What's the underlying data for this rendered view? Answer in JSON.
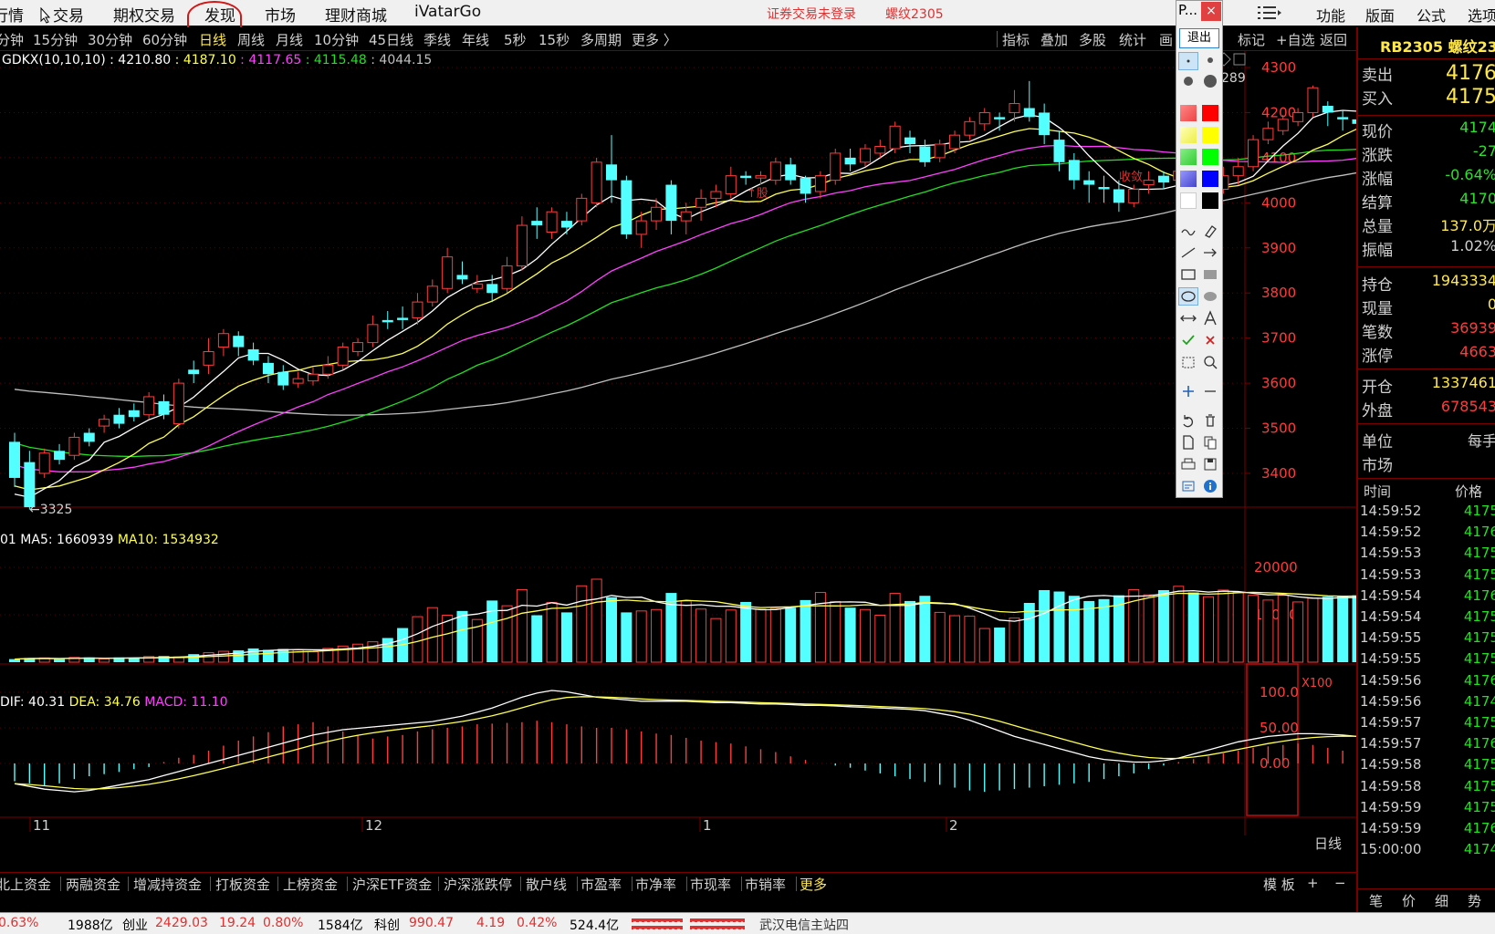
{
  "menu": {
    "items": [
      "行情",
      "交易",
      "期权交易",
      "发现",
      "市场",
      "理财商城",
      "iVatarGo"
    ],
    "notice_login": "证券交易未登录",
    "notice_contract": "螺纹2305",
    "right_items": [
      "功能",
      "版面",
      "公式",
      "选项"
    ]
  },
  "periods": [
    "分钟",
    "15分钟",
    "30分钟",
    "60分钟",
    "日线",
    "周线",
    "月线",
    "10分钟",
    "45日线",
    "季线",
    "年线",
    "5秒",
    "15秒",
    "多周期",
    "更多 〉"
  ],
  "period_active": "日线",
  "toolbar": [
    "指标",
    "叠加",
    "多股",
    "统计",
    "画",
    "标记",
    "+自选",
    "返回"
  ],
  "main_indicator": {
    "name": "GDKX(10,10,10)",
    "v1": "4210.80",
    "v2": "4187.10",
    "v3": "4117.65",
    "v4": "4115.48",
    "v5": "4044.15"
  },
  "annotations": {
    "low": "←3325",
    "high": "289",
    "text_a": "↑股",
    "text_b": "收敛"
  },
  "volume_indicator": {
    "prefix": "01",
    "ma5_label": "MA5:",
    "ma5": "1660939",
    "ma10_label": "MA10:",
    "ma10": "1534932",
    "unit": "X100"
  },
  "macd_indicator": {
    "dif_label": "DIF:",
    "dif": "40.31",
    "dea_label": "DEA:",
    "dea": "34.76",
    "macd_label": "MACD:",
    "macd": "11.10"
  },
  "period_label": "日线",
  "fund_bar": [
    "北上资金",
    "两融资金",
    "增减持资金",
    "打板资金",
    "上榜资金",
    "沪深ETF资金",
    "沪深涨跌停",
    "散户线",
    "市盈率",
    "市净率",
    "市现率",
    "市销率",
    "更多"
  ],
  "fund_right": [
    "模 板",
    "+",
    "−"
  ],
  "status": {
    "change": "0.63%",
    "amount1": "1988亿",
    "cy_label": "创业",
    "cy_price": "2429.03",
    "cy_chg": "19.24",
    "cy_pct": "0.80%",
    "amount2": "1584亿",
    "kc_label": "科创",
    "kc_price": "990.47",
    "kc_chg": "4.19",
    "kc_pct": "0.42%",
    "amount3": "524.4亿",
    "server": "武汉电信主站四"
  },
  "quote": {
    "title": "RB2305 螺纹23",
    "rows": [
      {
        "label": "卖出",
        "value": "4176",
        "color": "#ffe84a"
      },
      {
        "label": "买入",
        "value": "4175",
        "color": "#ffe84a"
      },
      {
        "label": "现价",
        "value": "4174",
        "color": "#2ee02e"
      },
      {
        "label": "涨跌",
        "value": "-27",
        "color": "#2ee02e"
      },
      {
        "label": "涨幅",
        "value": "-0.64%",
        "color": "#2ee02e"
      },
      {
        "label": "结算",
        "value": "4170",
        "color": "#2ee02e"
      },
      {
        "label": "总量",
        "value": "137.0万",
        "color": "#ffe84a"
      },
      {
        "label": "振幅",
        "value": "1.02%",
        "color": "#d0d0d0"
      },
      {
        "label": "持仓",
        "value": "1943334",
        "color": "#ffe84a"
      },
      {
        "label": "现量",
        "value": "0",
        "color": "#ffe84a"
      },
      {
        "label": "笔数",
        "value": "36939",
        "color": "#ff3c3c"
      },
      {
        "label": "涨停",
        "value": "4663",
        "color": "#ff3c3c"
      },
      {
        "label": "开仓",
        "value": "1337461",
        "color": "#ffe84a"
      },
      {
        "label": "外盘",
        "value": "678543",
        "color": "#ff3c3c"
      },
      {
        "label": "单位",
        "value": "每手",
        "color": "#d0d0d0"
      },
      {
        "label": "市场",
        "value": "",
        "color": "#d0d0d0"
      }
    ]
  },
  "ticks_header": {
    "time": "时间",
    "price": "价格"
  },
  "ticks": [
    {
      "time": "14:59:52",
      "price": "4175"
    },
    {
      "time": "14:59:52",
      "price": "4176"
    },
    {
      "time": "14:59:53",
      "price": "4175"
    },
    {
      "time": "14:59:53",
      "price": "4175"
    },
    {
      "time": "14:59:54",
      "price": "4176"
    },
    {
      "time": "14:59:54",
      "price": "4175"
    },
    {
      "time": "14:59:55",
      "price": "4175"
    },
    {
      "time": "14:59:55",
      "price": "4175"
    },
    {
      "time": "14:59:56",
      "price": "4176"
    },
    {
      "time": "14:59:56",
      "price": "4174"
    },
    {
      "time": "14:59:57",
      "price": "4175"
    },
    {
      "time": "14:59:57",
      "price": "4176"
    },
    {
      "time": "14:59:58",
      "price": "4175"
    },
    {
      "time": "14:59:58",
      "price": "4175"
    },
    {
      "time": "14:59:59",
      "price": "4175"
    },
    {
      "time": "14:59:59",
      "price": "4176"
    },
    {
      "time": "15:00:00",
      "price": "4174"
    }
  ],
  "rpanel_tabs": [
    "笔",
    "价",
    "细",
    "势"
  ],
  "palette": {
    "title": "P...",
    "close": "×",
    "exit": "退出"
  },
  "colors": {
    "up": "#ff3c3c",
    "down": "#54ffff",
    "ma5": "#ffffff",
    "ma10": "#ffff50",
    "ma20": "#ff40ff",
    "ma30": "#20e020",
    "ma60": "#c0c0c0",
    "dif": "#ffffff",
    "dea": "#ffff50",
    "frame": "#7a0000"
  },
  "chart_data": {
    "type": "candlestick",
    "price_ticks": [
      "4300",
      "4200",
      "4100",
      "4000",
      "3900",
      "3800",
      "3700",
      "3600",
      "3500",
      "3400"
    ],
    "price_range": [
      3325,
      4289
    ],
    "volume_ticks": [
      "20000",
      "10000"
    ],
    "macd_ticks": [
      "100.0",
      "50.00",
      "0.00"
    ],
    "x_labels": [
      "11",
      "12",
      "1",
      "2"
    ],
    "candles": [
      {
        "o": 3470,
        "c": 3390,
        "h": 3490,
        "l": 3370
      },
      {
        "o": 3425,
        "c": 3325,
        "h": 3450,
        "l": 3320
      },
      {
        "o": 3400,
        "c": 3445,
        "h": 3455,
        "l": 3390
      },
      {
        "o": 3450,
        "c": 3430,
        "h": 3465,
        "l": 3420
      },
      {
        "o": 3440,
        "c": 3480,
        "h": 3490,
        "l": 3430
      },
      {
        "o": 3490,
        "c": 3470,
        "h": 3500,
        "l": 3460
      },
      {
        "o": 3505,
        "c": 3520,
        "h": 3530,
        "l": 3490
      },
      {
        "o": 3530,
        "c": 3510,
        "h": 3545,
        "l": 3500
      },
      {
        "o": 3540,
        "c": 3525,
        "h": 3555,
        "l": 3515
      },
      {
        "o": 3530,
        "c": 3570,
        "h": 3580,
        "l": 3520
      },
      {
        "o": 3560,
        "c": 3530,
        "h": 3575,
        "l": 3520
      },
      {
        "o": 3510,
        "c": 3600,
        "h": 3610,
        "l": 3500
      },
      {
        "o": 3630,
        "c": 3620,
        "h": 3650,
        "l": 3600
      },
      {
        "o": 3640,
        "c": 3670,
        "h": 3700,
        "l": 3620
      },
      {
        "o": 3680,
        "c": 3710,
        "h": 3720,
        "l": 3660
      },
      {
        "o": 3705,
        "c": 3680,
        "h": 3715,
        "l": 3660
      },
      {
        "o": 3675,
        "c": 3650,
        "h": 3690,
        "l": 3640
      },
      {
        "o": 3645,
        "c": 3620,
        "h": 3660,
        "l": 3600
      },
      {
        "o": 3625,
        "c": 3595,
        "h": 3640,
        "l": 3585
      },
      {
        "o": 3600,
        "c": 3610,
        "h": 3625,
        "l": 3590
      },
      {
        "o": 3605,
        "c": 3620,
        "h": 3635,
        "l": 3595
      },
      {
        "o": 3620,
        "c": 3640,
        "h": 3660,
        "l": 3610
      },
      {
        "o": 3640,
        "c": 3680,
        "h": 3690,
        "l": 3630
      },
      {
        "o": 3670,
        "c": 3690,
        "h": 3700,
        "l": 3660
      },
      {
        "o": 3690,
        "c": 3730,
        "h": 3750,
        "l": 3680
      },
      {
        "o": 3740,
        "c": 3735,
        "h": 3760,
        "l": 3720
      },
      {
        "o": 3745,
        "c": 3740,
        "h": 3770,
        "l": 3720
      },
      {
        "o": 3745,
        "c": 3780,
        "h": 3800,
        "l": 3730
      },
      {
        "o": 3780,
        "c": 3815,
        "h": 3830,
        "l": 3770
      },
      {
        "o": 3810,
        "c": 3880,
        "h": 3900,
        "l": 3800
      },
      {
        "o": 3840,
        "c": 3830,
        "h": 3870,
        "l": 3820
      },
      {
        "o": 3810,
        "c": 3820,
        "h": 3840,
        "l": 3800
      },
      {
        "o": 3820,
        "c": 3800,
        "h": 3840,
        "l": 3780
      },
      {
        "o": 3810,
        "c": 3860,
        "h": 3880,
        "l": 3800
      },
      {
        "o": 3860,
        "c": 3950,
        "h": 3970,
        "l": 3850
      },
      {
        "o": 3960,
        "c": 3950,
        "h": 3990,
        "l": 3920
      },
      {
        "o": 3935,
        "c": 3980,
        "h": 3990,
        "l": 3920
      },
      {
        "o": 3960,
        "c": 3945,
        "h": 3980,
        "l": 3930
      },
      {
        "o": 3960,
        "c": 4010,
        "h": 4020,
        "l": 3950
      },
      {
        "o": 4000,
        "c": 4090,
        "h": 4100,
        "l": 3990
      },
      {
        "o": 4085,
        "c": 4050,
        "h": 4150,
        "l": 4000
      },
      {
        "o": 4050,
        "c": 3930,
        "h": 4060,
        "l": 3920
      },
      {
        "o": 3930,
        "c": 3960,
        "h": 3980,
        "l": 3900
      },
      {
        "o": 3960,
        "c": 3990,
        "h": 4010,
        "l": 3940
      },
      {
        "o": 4040,
        "c": 3960,
        "h": 4050,
        "l": 3930
      },
      {
        "o": 3960,
        "c": 3980,
        "h": 4000,
        "l": 3930
      },
      {
        "o": 3990,
        "c": 4010,
        "h": 4030,
        "l": 3960
      },
      {
        "o": 4010,
        "c": 4025,
        "h": 4040,
        "l": 3990
      },
      {
        "o": 4020,
        "c": 4060,
        "h": 4080,
        "l": 4010
      },
      {
        "o": 4060,
        "c": 4055,
        "h": 4070,
        "l": 4040
      },
      {
        "o": 4055,
        "c": 4060,
        "h": 4070,
        "l": 4040
      },
      {
        "o": 4050,
        "c": 4090,
        "h": 4100,
        "l": 4040
      },
      {
        "o": 4085,
        "c": 4050,
        "h": 4100,
        "l": 4040
      },
      {
        "o": 4055,
        "c": 4020,
        "h": 4060,
        "l": 4000
      },
      {
        "o": 4025,
        "c": 4060,
        "h": 4070,
        "l": 4010
      },
      {
        "o": 4050,
        "c": 4110,
        "h": 4120,
        "l": 4040
      },
      {
        "o": 4100,
        "c": 4085,
        "h": 4120,
        "l": 4070
      },
      {
        "o": 4090,
        "c": 4120,
        "h": 4130,
        "l": 4080
      },
      {
        "o": 4110,
        "c": 4125,
        "h": 4140,
        "l": 4100
      },
      {
        "o": 4120,
        "c": 4170,
        "h": 4180,
        "l": 4110
      },
      {
        "o": 4145,
        "c": 4130,
        "h": 4160,
        "l": 4110
      },
      {
        "o": 4125,
        "c": 4090,
        "h": 4140,
        "l": 4080
      },
      {
        "o": 4100,
        "c": 4130,
        "h": 4140,
        "l": 4090
      },
      {
        "o": 4120,
        "c": 4150,
        "h": 4160,
        "l": 4110
      },
      {
        "o": 4150,
        "c": 4180,
        "h": 4190,
        "l": 4140
      },
      {
        "o": 4175,
        "c": 4200,
        "h": 4210,
        "l": 4160
      },
      {
        "o": 4190,
        "c": 4185,
        "h": 4200,
        "l": 4160
      },
      {
        "o": 4200,
        "c": 4220,
        "h": 4250,
        "l": 4180
      },
      {
        "o": 4210,
        "c": 4190,
        "h": 4270,
        "l": 4180
      },
      {
        "o": 4200,
        "c": 4150,
        "h": 4220,
        "l": 4130
      },
      {
        "o": 4140,
        "c": 4090,
        "h": 4160,
        "l": 4070
      },
      {
        "o": 4095,
        "c": 4050,
        "h": 4110,
        "l": 4030
      },
      {
        "o": 4050,
        "c": 4040,
        "h": 4070,
        "l": 4000
      },
      {
        "o": 4035,
        "c": 4030,
        "h": 4060,
        "l": 4000
      },
      {
        "o": 4030,
        "c": 4000,
        "h": 4050,
        "l": 3980
      },
      {
        "o": 4000,
        "c": 4030,
        "h": 4040,
        "l": 3990
      },
      {
        "o": 4040,
        "c": 4050,
        "h": 4070,
        "l": 4020
      },
      {
        "o": 4060,
        "c": 4045,
        "h": 4070,
        "l": 4030
      },
      {
        "o": 4050,
        "c": 4070,
        "h": 4080,
        "l": 4040
      },
      {
        "o": 4075,
        "c": 3995,
        "h": 4080,
        "l": 3990
      },
      {
        "o": 4000,
        "c": 4020,
        "h": 4030,
        "l": 3960
      },
      {
        "o": 4030,
        "c": 4060,
        "h": 4080,
        "l": 4020
      },
      {
        "o": 4060,
        "c": 4080,
        "h": 4100,
        "l": 4040
      },
      {
        "o": 4080,
        "c": 4140,
        "h": 4150,
        "l": 4070
      },
      {
        "o": 4140,
        "c": 4165,
        "h": 4180,
        "l": 4130
      },
      {
        "o": 4160,
        "c": 4185,
        "h": 4195,
        "l": 4150
      },
      {
        "o": 4180,
        "c": 4200,
        "h": 4210,
        "l": 4170
      },
      {
        "o": 4200,
        "c": 4255,
        "h": 4260,
        "l": 4190
      },
      {
        "o": 4215,
        "c": 4200,
        "h": 4225,
        "l": 4170
      },
      {
        "o": 4190,
        "c": 4185,
        "h": 4205,
        "l": 4160
      },
      {
        "o": 4185,
        "c": 4175,
        "h": 4195,
        "l": 4150
      }
    ],
    "volumes": [
      650,
      900,
      900,
      650,
      1000,
      1000,
      700,
      1000,
      800,
      1200,
      1300,
      1100,
      1700,
      2000,
      2300,
      2500,
      2900,
      2600,
      2800,
      2600,
      2200,
      2900,
      3400,
      3800,
      4300,
      5100,
      7200,
      9600,
      11500,
      9900,
      10800,
      9000,
      13000,
      11900,
      15300,
      9900,
      12600,
      10500,
      16100,
      17500,
      13700,
      10500,
      10800,
      11100,
      14600,
      12900,
      11200,
      9200,
      11000,
      12700,
      11200,
      11300,
      11500,
      13100,
      14700,
      12800,
      11500,
      11100,
      9900,
      14500,
      12900,
      14000,
      10500,
      9800,
      9700,
      7100,
      7300,
      9300,
      12500,
      15200,
      14900,
      14000,
      12900,
      13300,
      14100,
      15300,
      14200,
      15200,
      16000,
      14700,
      13800,
      15200,
      14800,
      14100,
      13100,
      14100,
      12700,
      13500,
      13800,
      14000,
      14100
    ],
    "macd_bars": [
      -25,
      -28,
      -32,
      -28,
      -22,
      -18,
      -15,
      -12,
      -8,
      -5,
      2,
      8,
      12,
      18,
      25,
      32,
      38,
      44,
      52,
      55,
      58,
      52,
      45,
      40,
      35,
      38,
      40,
      45,
      48,
      50,
      52,
      55,
      56,
      57,
      58,
      60,
      58,
      55,
      52,
      50,
      50,
      48,
      45,
      42,
      40,
      36,
      32,
      30,
      28,
      24,
      20,
      16,
      10,
      5,
      0,
      -3,
      -6,
      -10,
      -14,
      -18,
      -22,
      -26,
      -30,
      -34,
      -38,
      -40,
      -38,
      -36,
      -34,
      -32,
      -30,
      -28,
      -26,
      -22,
      -18,
      -14,
      -8,
      -3,
      2,
      6,
      10,
      14,
      18,
      22,
      24,
      26,
      28,
      26,
      22,
      18,
      12
    ]
  }
}
